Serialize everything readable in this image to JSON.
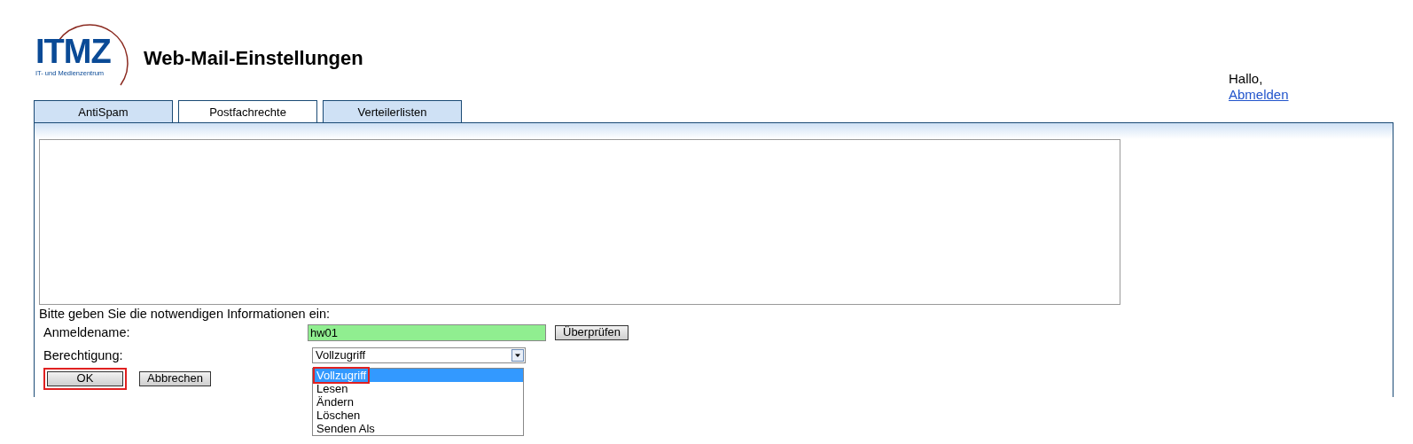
{
  "logo": {
    "text": "ITMZ",
    "subtitle": "IT- und Medienzentrum"
  },
  "title": "Web-Mail-Einstellungen",
  "user": {
    "greeting": "Hallo,",
    "logout": "Abmelden"
  },
  "tabs": [
    {
      "label": "AntiSpam",
      "selected": false
    },
    {
      "label": "Postfachrechte",
      "selected": true
    },
    {
      "label": "Verteilerlisten",
      "selected": false
    }
  ],
  "form": {
    "instruction": "Bitte geben Sie die notwendigen Informationen ein:",
    "login_label": "Anmeldename:",
    "login_value": "hw01",
    "check_button": "Überprüfen",
    "permission_label": "Berechtigung:",
    "permission_value": "Vollzugriff",
    "options": [
      {
        "label": "Vollzugriff",
        "selected": true,
        "highlighted": true
      },
      {
        "label": "Lesen",
        "selected": false,
        "highlighted": false
      },
      {
        "label": "Ändern",
        "selected": false,
        "highlighted": false
      },
      {
        "label": "Löschen",
        "selected": false,
        "highlighted": false
      },
      {
        "label": "Senden Als",
        "selected": false,
        "highlighted": false
      }
    ],
    "buttons": [
      {
        "label": "OK",
        "highlighted": true
      },
      {
        "label": "Abbrechen",
        "highlighted": false
      }
    ]
  }
}
